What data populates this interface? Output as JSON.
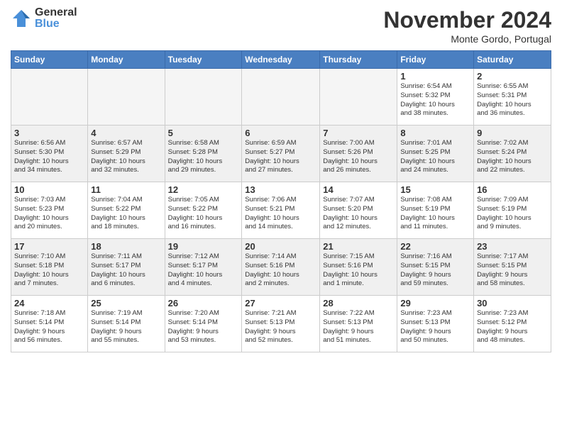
{
  "header": {
    "logo_general": "General",
    "logo_blue": "Blue",
    "month_title": "November 2024",
    "location": "Monte Gordo, Portugal"
  },
  "weekdays": [
    "Sunday",
    "Monday",
    "Tuesday",
    "Wednesday",
    "Thursday",
    "Friday",
    "Saturday"
  ],
  "weeks": [
    [
      {
        "day": "",
        "empty": true
      },
      {
        "day": "",
        "empty": true
      },
      {
        "day": "",
        "empty": true
      },
      {
        "day": "",
        "empty": true
      },
      {
        "day": "",
        "empty": true
      },
      {
        "day": "1",
        "info": "Sunrise: 6:54 AM\nSunset: 5:32 PM\nDaylight: 10 hours\nand 38 minutes."
      },
      {
        "day": "2",
        "info": "Sunrise: 6:55 AM\nSunset: 5:31 PM\nDaylight: 10 hours\nand 36 minutes."
      }
    ],
    [
      {
        "day": "3",
        "info": "Sunrise: 6:56 AM\nSunset: 5:30 PM\nDaylight: 10 hours\nand 34 minutes."
      },
      {
        "day": "4",
        "info": "Sunrise: 6:57 AM\nSunset: 5:29 PM\nDaylight: 10 hours\nand 32 minutes."
      },
      {
        "day": "5",
        "info": "Sunrise: 6:58 AM\nSunset: 5:28 PM\nDaylight: 10 hours\nand 29 minutes."
      },
      {
        "day": "6",
        "info": "Sunrise: 6:59 AM\nSunset: 5:27 PM\nDaylight: 10 hours\nand 27 minutes."
      },
      {
        "day": "7",
        "info": "Sunrise: 7:00 AM\nSunset: 5:26 PM\nDaylight: 10 hours\nand 26 minutes."
      },
      {
        "day": "8",
        "info": "Sunrise: 7:01 AM\nSunset: 5:25 PM\nDaylight: 10 hours\nand 24 minutes."
      },
      {
        "day": "9",
        "info": "Sunrise: 7:02 AM\nSunset: 5:24 PM\nDaylight: 10 hours\nand 22 minutes."
      }
    ],
    [
      {
        "day": "10",
        "info": "Sunrise: 7:03 AM\nSunset: 5:23 PM\nDaylight: 10 hours\nand 20 minutes."
      },
      {
        "day": "11",
        "info": "Sunrise: 7:04 AM\nSunset: 5:22 PM\nDaylight: 10 hours\nand 18 minutes."
      },
      {
        "day": "12",
        "info": "Sunrise: 7:05 AM\nSunset: 5:22 PM\nDaylight: 10 hours\nand 16 minutes."
      },
      {
        "day": "13",
        "info": "Sunrise: 7:06 AM\nSunset: 5:21 PM\nDaylight: 10 hours\nand 14 minutes."
      },
      {
        "day": "14",
        "info": "Sunrise: 7:07 AM\nSunset: 5:20 PM\nDaylight: 10 hours\nand 12 minutes."
      },
      {
        "day": "15",
        "info": "Sunrise: 7:08 AM\nSunset: 5:19 PM\nDaylight: 10 hours\nand 11 minutes."
      },
      {
        "day": "16",
        "info": "Sunrise: 7:09 AM\nSunset: 5:19 PM\nDaylight: 10 hours\nand 9 minutes."
      }
    ],
    [
      {
        "day": "17",
        "info": "Sunrise: 7:10 AM\nSunset: 5:18 PM\nDaylight: 10 hours\nand 7 minutes."
      },
      {
        "day": "18",
        "info": "Sunrise: 7:11 AM\nSunset: 5:17 PM\nDaylight: 10 hours\nand 6 minutes."
      },
      {
        "day": "19",
        "info": "Sunrise: 7:12 AM\nSunset: 5:17 PM\nDaylight: 10 hours\nand 4 minutes."
      },
      {
        "day": "20",
        "info": "Sunrise: 7:14 AM\nSunset: 5:16 PM\nDaylight: 10 hours\nand 2 minutes."
      },
      {
        "day": "21",
        "info": "Sunrise: 7:15 AM\nSunset: 5:16 PM\nDaylight: 10 hours\nand 1 minute."
      },
      {
        "day": "22",
        "info": "Sunrise: 7:16 AM\nSunset: 5:15 PM\nDaylight: 9 hours\nand 59 minutes."
      },
      {
        "day": "23",
        "info": "Sunrise: 7:17 AM\nSunset: 5:15 PM\nDaylight: 9 hours\nand 58 minutes."
      }
    ],
    [
      {
        "day": "24",
        "info": "Sunrise: 7:18 AM\nSunset: 5:14 PM\nDaylight: 9 hours\nand 56 minutes."
      },
      {
        "day": "25",
        "info": "Sunrise: 7:19 AM\nSunset: 5:14 PM\nDaylight: 9 hours\nand 55 minutes."
      },
      {
        "day": "26",
        "info": "Sunrise: 7:20 AM\nSunset: 5:14 PM\nDaylight: 9 hours\nand 53 minutes."
      },
      {
        "day": "27",
        "info": "Sunrise: 7:21 AM\nSunset: 5:13 PM\nDaylight: 9 hours\nand 52 minutes."
      },
      {
        "day": "28",
        "info": "Sunrise: 7:22 AM\nSunset: 5:13 PM\nDaylight: 9 hours\nand 51 minutes."
      },
      {
        "day": "29",
        "info": "Sunrise: 7:23 AM\nSunset: 5:13 PM\nDaylight: 9 hours\nand 50 minutes."
      },
      {
        "day": "30",
        "info": "Sunrise: 7:23 AM\nSunset: 5:12 PM\nDaylight: 9 hours\nand 48 minutes."
      }
    ]
  ]
}
